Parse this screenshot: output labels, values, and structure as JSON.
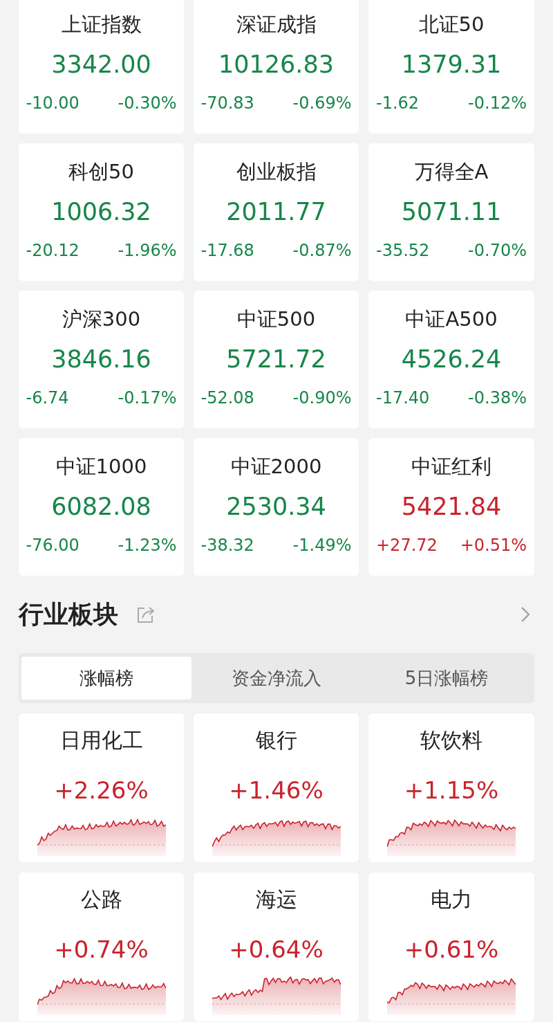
{
  "indices": [
    {
      "name": "上证指数",
      "value": "3342.00",
      "change": "-10.00",
      "pct": "-0.30%",
      "color": "#17864a"
    },
    {
      "name": "深证成指",
      "value": "10126.83",
      "change": "-70.83",
      "pct": "-0.69%",
      "color": "#17864a"
    },
    {
      "name": "北证50",
      "value": "1379.31",
      "change": "-1.62",
      "pct": "-0.12%",
      "color": "#17864a"
    },
    {
      "name": "科创50",
      "value": "1006.32",
      "change": "-20.12",
      "pct": "-1.96%",
      "color": "#17864a"
    },
    {
      "name": "创业板指",
      "value": "2011.77",
      "change": "-17.68",
      "pct": "-0.87%",
      "color": "#17864a"
    },
    {
      "name": "万得全A",
      "value": "5071.11",
      "change": "-35.52",
      "pct": "-0.70%",
      "color": "#17864a"
    },
    {
      "name": "沪深300",
      "value": "3846.16",
      "change": "-6.74",
      "pct": "-0.17%",
      "color": "#17864a"
    },
    {
      "name": "中证500",
      "value": "5721.72",
      "change": "-52.08",
      "pct": "-0.90%",
      "color": "#17864a"
    },
    {
      "name": "中证A500",
      "value": "4526.24",
      "change": "-17.40",
      "pct": "-0.38%",
      "color": "#17864a"
    },
    {
      "name": "中证1000",
      "value": "6082.08",
      "change": "-76.00",
      "pct": "-1.23%",
      "color": "#17864a"
    },
    {
      "name": "中证2000",
      "value": "2530.34",
      "change": "-38.32",
      "pct": "-1.49%",
      "color": "#17864a"
    },
    {
      "name": "中证红利",
      "value": "5421.84",
      "change": "+27.72",
      "pct": "+0.51%",
      "color": "#c8232c"
    }
  ],
  "sector_section": {
    "title": "行业板块",
    "tabs": [
      {
        "label": "涨幅榜",
        "selected": true
      },
      {
        "label": "资金净流入",
        "selected": false
      },
      {
        "label": "5日涨幅榜",
        "selected": false
      }
    ],
    "sectors": [
      {
        "name": "日用化工",
        "pct": "+2.26%",
        "color": "#c8232c"
      },
      {
        "name": "银行",
        "pct": "+1.46%",
        "color": "#c8232c"
      },
      {
        "name": "软饮料",
        "pct": "+1.15%",
        "color": "#c8232c"
      },
      {
        "name": "公路",
        "pct": "+0.74%",
        "color": "#c8232c"
      },
      {
        "name": "海运",
        "pct": "+0.64%",
        "color": "#c8232c"
      },
      {
        "name": "电力",
        "pct": "+0.61%",
        "color": "#c8232c"
      }
    ]
  }
}
